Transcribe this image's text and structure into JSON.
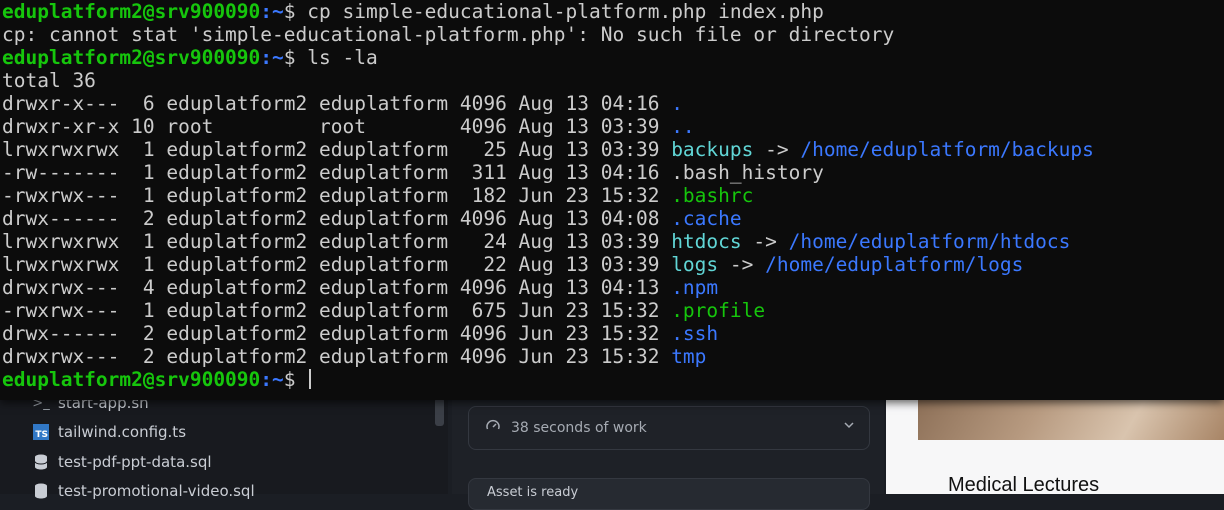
{
  "terminal": {
    "prompt_user": "eduplatform2@srv900090",
    "prompt_path": ":~",
    "prompt_symbol": "$",
    "cmd1": " cp simple-educational-platform.php index.php",
    "err1": "cp: cannot stat 'simple-educational-platform.php': No such file or directory",
    "cmd2": " ls -la",
    "total": "total 36",
    "rows": [
      {
        "meta": "drwxr-x---  6 eduplatform2 eduplatform 4096 Aug 13 04:16 ",
        "name": ".",
        "type": "dir",
        "arrow": "",
        "target": ""
      },
      {
        "meta": "drwxr-xr-x 10 root         root        4096 Aug 13 03:39 ",
        "name": "..",
        "type": "dir",
        "arrow": "",
        "target": ""
      },
      {
        "meta": "lrwxrwxrwx  1 eduplatform2 eduplatform   25 Aug 13 03:39 ",
        "name": "backups",
        "type": "link",
        "arrow": " -> ",
        "target": "/home/eduplatform/backups"
      },
      {
        "meta": "-rw-------  1 eduplatform2 eduplatform  311 Aug 13 04:16 ",
        "name": ".bash_history",
        "type": "file",
        "arrow": "",
        "target": ""
      },
      {
        "meta": "-rwxrwx---  1 eduplatform2 eduplatform  182 Jun 23 15:32 ",
        "name": ".bashrc",
        "type": "exe",
        "arrow": "",
        "target": ""
      },
      {
        "meta": "drwx------  2 eduplatform2 eduplatform 4096 Aug 13 04:08 ",
        "name": ".cache",
        "type": "dir",
        "arrow": "",
        "target": ""
      },
      {
        "meta": "lrwxrwxrwx  1 eduplatform2 eduplatform   24 Aug 13 03:39 ",
        "name": "htdocs",
        "type": "link",
        "arrow": " -> ",
        "target": "/home/eduplatform/htdocs"
      },
      {
        "meta": "lrwxrwxrwx  1 eduplatform2 eduplatform   22 Aug 13 03:39 ",
        "name": "logs",
        "type": "link",
        "arrow": " -> ",
        "target": "/home/eduplatform/logs"
      },
      {
        "meta": "drwxrwx---  4 eduplatform2 eduplatform 4096 Aug 13 04:13 ",
        "name": ".npm",
        "type": "dir",
        "arrow": "",
        "target": ""
      },
      {
        "meta": "-rwxrwx---  1 eduplatform2 eduplatform  675 Jun 23 15:32 ",
        "name": ".profile",
        "type": "exe",
        "arrow": "",
        "target": ""
      },
      {
        "meta": "drwx------  2 eduplatform2 eduplatform 4096 Jun 23 15:32 ",
        "name": ".ssh",
        "type": "dir",
        "arrow": "",
        "target": ""
      },
      {
        "meta": "drwxrwx---  2 eduplatform2 eduplatform 4096 Jun 23 15:32 ",
        "name": "tmp",
        "type": "dir",
        "arrow": "",
        "target": ""
      }
    ],
    "colors": {
      "background": "#0c0c0c",
      "text": "#cccccc",
      "prompt_user": "#16c60c",
      "dir": "#3b78ff",
      "link": "#61d6d6",
      "exe": "#16c60c"
    }
  },
  "background_app": {
    "files": [
      {
        "name": "start-app.sh",
        "icon": "terminal-icon"
      },
      {
        "name": "tailwind.config.ts",
        "icon": "typescript-icon"
      },
      {
        "name": "test-pdf-ppt-data.sql",
        "icon": "database-icon"
      },
      {
        "name": "test-promotional-video.sql",
        "icon": "database-icon"
      }
    ],
    "work_status": "38 seconds of work",
    "asset_status": "Asset is ready",
    "panel_title": "Medical Lectures"
  }
}
